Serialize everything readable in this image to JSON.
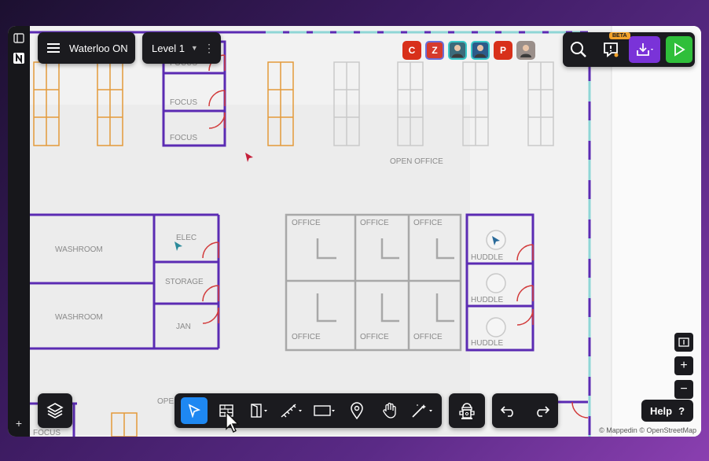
{
  "header": {
    "building_name": "Waterloo ON",
    "level_label": "Level 1"
  },
  "collaborators": [
    {
      "initial": "C",
      "color": "#d8301a",
      "border": "#d8301a"
    },
    {
      "initial": "Z",
      "color": "#d63a2c",
      "border": "#6a6fd8"
    },
    {
      "initial": "",
      "color": "#3b6a7a",
      "border": "#39c6c6"
    },
    {
      "initial": "",
      "color": "#2c5a8a",
      "border": "#39c6c6"
    },
    {
      "initial": "P",
      "color": "#d8301a",
      "border": "#d8301a"
    },
    {
      "initial": "",
      "color": "#9a8f8a",
      "border": "#9a8f8a"
    }
  ],
  "toolbar": {
    "beta_label": "BETA",
    "help_label": "Help",
    "help_icon": "?"
  },
  "map": {
    "rooms": {
      "focus_1": "FOCUS",
      "focus_2": "FOCUS",
      "open_office": "OPEN OFFICE",
      "washroom_1": "WASHROOM",
      "washroom_2": "WASHROOM",
      "elec": "ELEC",
      "storage": "STORAGE",
      "jan": "JAN",
      "office_1": "OFFICE",
      "office_2": "OFFICE",
      "office_3": "OFFICE",
      "office_4": "OFFICE",
      "office_5": "OFFICE",
      "office_6": "OFFICE",
      "huddle_1": "HUDDLE",
      "huddle_2": "HUDDLE",
      "huddle_3": "HUDDLE",
      "focus_bottom": "FOCUS",
      "ope_partial": "OPE"
    },
    "attribution": "© Mappedin © OpenStreetMap"
  },
  "colors": {
    "wall_purple": "#5b2bb3",
    "door_red": "#d23a3a",
    "desk_orange": "#e39a3a",
    "accent_purple": "#7a33d8",
    "play_green": "#2fbf3a",
    "select_blue": "#1e88f2"
  },
  "icons": [
    "sidebar-toggle-icon",
    "logo-icon",
    "plus-icon",
    "hamburger-icon",
    "kebab-icon",
    "chevron-down-icon",
    "search-icon",
    "alert-icon",
    "download-icon",
    "play-icon",
    "layers-icon",
    "pointer-icon",
    "wall-grid-icon",
    "door-icon",
    "stairs-icon",
    "rectangle-icon",
    "location-pin-icon",
    "hand-icon",
    "magic-wand-icon",
    "hydrant-icon",
    "undo-icon",
    "redo-icon",
    "zoom-fit-icon",
    "zoom-in-icon",
    "zoom-out-icon"
  ]
}
